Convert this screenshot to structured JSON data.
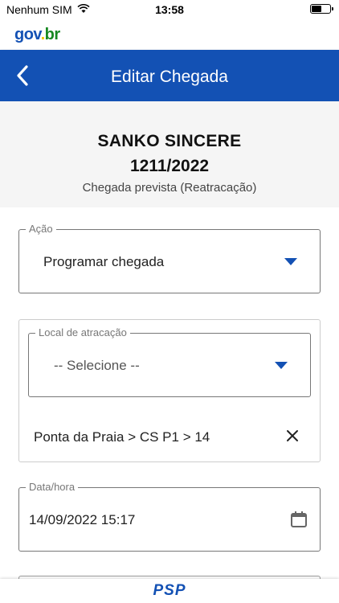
{
  "status_bar": {
    "carrier": "Nenhum SIM",
    "time": "13:58",
    "battery_level": 0.6
  },
  "gov": {
    "logo_part1": "gov",
    "logo_dot": ".",
    "logo_part2": "br"
  },
  "header": {
    "title": "Editar Chegada",
    "back_icon": "chevron-left-icon"
  },
  "vessel": {
    "name": "SANKO SINCERE",
    "number": "1211/2022",
    "subtitle": "Chegada prevista (Reatracação)"
  },
  "form": {
    "acao": {
      "label": "Ação",
      "value": "Programar chegada"
    },
    "local": {
      "label": "Local de atracação",
      "value": "-- Selecione --",
      "selected_item": "Ponta da Praia > CS P1 > 14"
    },
    "datahora": {
      "label": "Data/hora",
      "value": "14/09/2022 15:17"
    }
  },
  "footer": {
    "logo": "PSP"
  },
  "colors": {
    "primary": "#1351b4",
    "background_section": "#f5f5f5"
  }
}
